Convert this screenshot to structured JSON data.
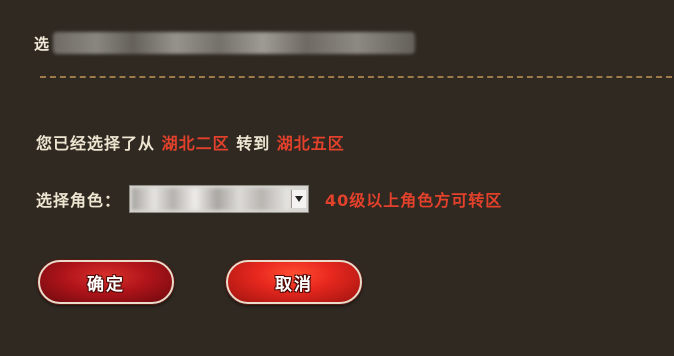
{
  "title": {
    "initial": "选"
  },
  "transfer": {
    "prefix": "您已经选择了从",
    "from_server": "湖北二区",
    "middle": "转到",
    "to_server": "湖北五区"
  },
  "role": {
    "label": "选择角色：",
    "note": "40级以上角色方可转区"
  },
  "buttons": {
    "confirm": "确定",
    "cancel": "取消"
  },
  "colors": {
    "background": "#2f2922",
    "highlight": "#e3412b",
    "text": "#efe6d2",
    "divider": "#9c7a4a"
  },
  "icons": {
    "select_arrow": "chevron-down-icon"
  }
}
